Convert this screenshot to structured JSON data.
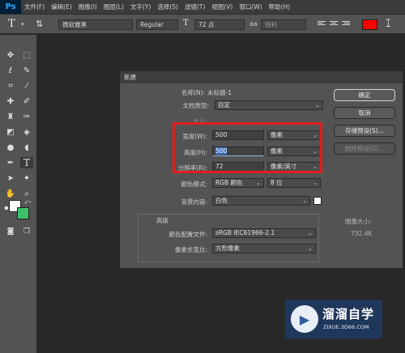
{
  "menubar": {
    "logo": "Ps",
    "items": [
      "文件(F)",
      "编辑(E)",
      "图像(I)",
      "图层(L)",
      "文字(Y)",
      "选择(S)",
      "滤镜(T)",
      "视图(V)",
      "窗口(W)",
      "帮助(H)"
    ]
  },
  "options": {
    "font_family": "微软雅黑",
    "font_style": "Regular",
    "font_size": "72 点",
    "antialias": "锐利",
    "text_color": "#ff0000"
  },
  "toolbar": {
    "foreground": "#ffffff",
    "background": "#3ec06a"
  },
  "dialog": {
    "title": "新建",
    "name_label": "名称(N):",
    "name_value": "未标题-1",
    "doc_type_label": "文档类型:",
    "doc_type_value": "自定",
    "size_label": "大小:",
    "width_label": "宽度(W):",
    "width_value": "500",
    "width_unit": "像素",
    "height_label": "高度(H):",
    "height_value": "500",
    "height_unit": "像素",
    "resolution_label": "分辨率(R):",
    "resolution_value": "72",
    "resolution_unit": "像素/英寸",
    "color_mode_label": "颜色模式:",
    "color_mode_value": "RGB 颜色",
    "bit_depth_value": "8 位",
    "bg_content_label": "背景内容:",
    "bg_content_value": "白色",
    "advanced_label": "高级",
    "color_profile_label": "颜色配置文件:",
    "color_profile_value": "sRGB IEC61966-2.1",
    "pixel_aspect_label": "像素长宽比:",
    "pixel_aspect_value": "方形像素",
    "ok_button": "确定",
    "cancel_button": "取消",
    "save_preset_button": "存储预设(S)...",
    "delete_preset_button": "删除预设(D)...",
    "image_size_label": "图像大小:",
    "image_size_value": "732.4K"
  },
  "watermark": {
    "brand": "溜溜自学",
    "url": "ZIXUE.3D66.COM"
  }
}
